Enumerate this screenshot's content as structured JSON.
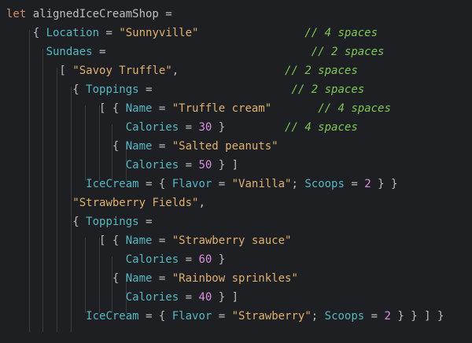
{
  "code": {
    "lines": [
      [
        {
          "t": "let ",
          "c": "kw"
        },
        {
          "t": "alignedIceCreamShop =",
          "c": "punc"
        }
      ],
      [
        {
          "t": "    { ",
          "c": "punc"
        },
        {
          "t": "Location",
          "c": "prop"
        },
        {
          "t": " = ",
          "c": "punc"
        },
        {
          "t": "\"Sunnyville\"",
          "c": "strw"
        },
        {
          "t": "                // 4 spaces",
          "c": "cm"
        }
      ],
      [
        {
          "t": "      ",
          "c": "punc"
        },
        {
          "t": "Sundaes",
          "c": "prop"
        },
        {
          "t": " =                               ",
          "c": "punc"
        },
        {
          "t": "// 2 spaces",
          "c": "cm"
        }
      ],
      [
        {
          "t": "        [ ",
          "c": "punc"
        },
        {
          "t": "\"Savoy Truffle\"",
          "c": "strw"
        },
        {
          "t": ",                ",
          "c": "punc"
        },
        {
          "t": "// 2 spaces",
          "c": "cm"
        }
      ],
      [
        {
          "t": "          { ",
          "c": "punc"
        },
        {
          "t": "Toppings",
          "c": "prop"
        },
        {
          "t": " =                     ",
          "c": "punc"
        },
        {
          "t": "// 2 spaces",
          "c": "cm"
        }
      ],
      [
        {
          "t": "              [ { ",
          "c": "punc"
        },
        {
          "t": "Name",
          "c": "prop"
        },
        {
          "t": " = ",
          "c": "punc"
        },
        {
          "t": "\"Truffle cream\"",
          "c": "strw"
        },
        {
          "t": "       ",
          "c": "punc"
        },
        {
          "t": "// 4 spaces",
          "c": "cm"
        }
      ],
      [
        {
          "t": "                  ",
          "c": "punc"
        },
        {
          "t": "Calories",
          "c": "prop"
        },
        {
          "t": " = ",
          "c": "punc"
        },
        {
          "t": "30",
          "c": "num2"
        },
        {
          "t": " }         ",
          "c": "punc"
        },
        {
          "t": "// 4 spaces",
          "c": "cm"
        }
      ],
      [
        {
          "t": "                { ",
          "c": "punc"
        },
        {
          "t": "Name",
          "c": "prop"
        },
        {
          "t": " = ",
          "c": "punc"
        },
        {
          "t": "\"Salted peanuts\"",
          "c": "strw"
        }
      ],
      [
        {
          "t": "                  ",
          "c": "punc"
        },
        {
          "t": "Calories",
          "c": "prop"
        },
        {
          "t": " = ",
          "c": "punc"
        },
        {
          "t": "50",
          "c": "num2"
        },
        {
          "t": " } ]",
          "c": "punc"
        }
      ],
      [
        {
          "t": "            ",
          "c": "punc"
        },
        {
          "t": "IceCream",
          "c": "prop"
        },
        {
          "t": " = { ",
          "c": "punc"
        },
        {
          "t": "Flavor",
          "c": "prop"
        },
        {
          "t": " = ",
          "c": "punc"
        },
        {
          "t": "\"Vanilla\"",
          "c": "strw"
        },
        {
          "t": "; ",
          "c": "punc"
        },
        {
          "t": "Scoops",
          "c": "prop"
        },
        {
          "t": " = ",
          "c": "punc"
        },
        {
          "t": "2",
          "c": "num2"
        },
        {
          "t": " } }",
          "c": "punc"
        }
      ],
      [
        {
          "t": "          ",
          "c": "punc"
        },
        {
          "t": "\"Strawberry Fields\"",
          "c": "strw"
        },
        {
          "t": ",",
          "c": "punc"
        }
      ],
      [
        {
          "t": "          { ",
          "c": "punc"
        },
        {
          "t": "Toppings",
          "c": "prop"
        },
        {
          "t": " =",
          "c": "punc"
        }
      ],
      [
        {
          "t": "              [ { ",
          "c": "punc"
        },
        {
          "t": "Name",
          "c": "prop"
        },
        {
          "t": " = ",
          "c": "punc"
        },
        {
          "t": "\"Strawberry sauce\"",
          "c": "strw"
        }
      ],
      [
        {
          "t": "                  ",
          "c": "punc"
        },
        {
          "t": "Calories",
          "c": "prop"
        },
        {
          "t": " = ",
          "c": "punc"
        },
        {
          "t": "60",
          "c": "num2"
        },
        {
          "t": " }",
          "c": "punc"
        }
      ],
      [
        {
          "t": "                { ",
          "c": "punc"
        },
        {
          "t": "Name",
          "c": "prop"
        },
        {
          "t": " = ",
          "c": "punc"
        },
        {
          "t": "\"Rainbow sprinkles\"",
          "c": "strw"
        }
      ],
      [
        {
          "t": "                  ",
          "c": "punc"
        },
        {
          "t": "Calories",
          "c": "prop"
        },
        {
          "t": " = ",
          "c": "punc"
        },
        {
          "t": "40",
          "c": "num2"
        },
        {
          "t": " } ]",
          "c": "punc"
        }
      ],
      [
        {
          "t": "            ",
          "c": "punc"
        },
        {
          "t": "IceCream",
          "c": "prop"
        },
        {
          "t": " = { ",
          "c": "punc"
        },
        {
          "t": "Flavor",
          "c": "prop"
        },
        {
          "t": " = ",
          "c": "punc"
        },
        {
          "t": "\"Strawberry\"",
          "c": "strw"
        },
        {
          "t": "; ",
          "c": "punc"
        },
        {
          "t": "Scoops",
          "c": "prop"
        },
        {
          "t": " = ",
          "c": "punc"
        },
        {
          "t": "2",
          "c": "num2"
        },
        {
          "t": " } } ] }",
          "c": "punc"
        }
      ]
    ]
  },
  "colors": {
    "background": "#1e1f22",
    "keyword": "#cf8e6d",
    "property": "#56b6c2",
    "string": "#e0b070",
    "number": "#d98fe0",
    "comment": "#7ec75a",
    "text": "#bcbec4",
    "indent_guide": "#393b40"
  }
}
